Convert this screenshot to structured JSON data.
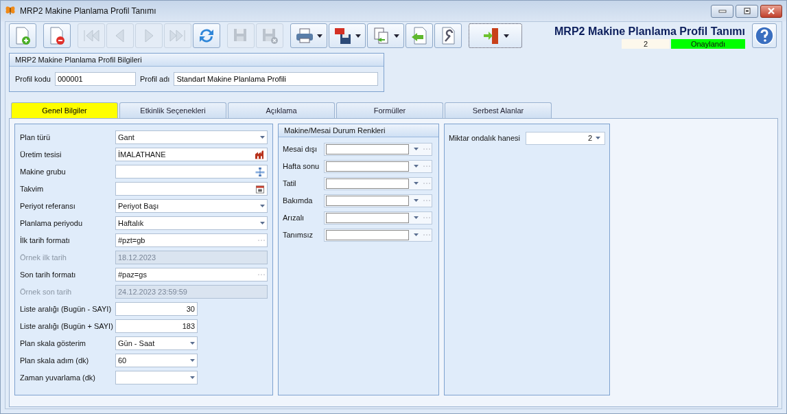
{
  "window": {
    "title": "MRP2 Makine Planlama Profil Tanımı"
  },
  "toolbar": [
    {
      "kind": "new",
      "disabled": false,
      "menu": false
    },
    {
      "kind": "delete",
      "disabled": false,
      "menu": false
    },
    {
      "kind": "first",
      "disabled": true,
      "menu": false
    },
    {
      "kind": "prev",
      "disabled": true,
      "menu": false
    },
    {
      "kind": "next",
      "disabled": true,
      "menu": false
    },
    {
      "kind": "last",
      "disabled": true,
      "menu": false
    },
    {
      "kind": "refresh",
      "disabled": false,
      "menu": false
    },
    {
      "kind": "save",
      "disabled": true,
      "menu": false
    },
    {
      "kind": "cancel",
      "disabled": true,
      "menu": false
    },
    {
      "kind": "print",
      "disabled": false,
      "menu": true
    },
    {
      "kind": "pdf",
      "disabled": false,
      "menu": true
    },
    {
      "kind": "copy",
      "disabled": false,
      "menu": true
    },
    {
      "kind": "import",
      "disabled": false,
      "menu": false
    },
    {
      "kind": "tools",
      "disabled": false,
      "menu": false
    },
    {
      "kind": "exit",
      "disabled": false,
      "menu": true
    }
  ],
  "header": {
    "title": "MRP2 Makine Planlama Profil Tanımı",
    "record_no": "2",
    "status": "Onaylandı"
  },
  "profile": {
    "title": "MRP2 Makine Planlama Profil Bilgileri",
    "code_label": "Profil kodu",
    "code": "000001",
    "name_label": "Profil adı",
    "name": "Standart Makine Planlama Profili"
  },
  "tabs": [
    {
      "label": "Genel Bilgiler",
      "selected": true
    },
    {
      "label": "Etkinlik Seçenekleri",
      "selected": false
    },
    {
      "label": "Açıklama",
      "selected": false
    },
    {
      "label": "Formüller",
      "selected": false
    },
    {
      "label": "Serbest Alanlar",
      "selected": false
    }
  ],
  "general": [
    {
      "label": "Plan türü",
      "value": "Gant",
      "kind": "dropdown",
      "disabled": false
    },
    {
      "label": "Üretim tesisi",
      "value": "İMALATHANE",
      "kind": "factory",
      "disabled": false
    },
    {
      "label": "Makine grubu",
      "kind": "tree",
      "disabled": false
    },
    {
      "label": "Takvim",
      "kind": "calendar",
      "disabled": false
    },
    {
      "label": "Periyot referansı",
      "value": "Periyot Başı",
      "kind": "dropdown",
      "disabled": false
    },
    {
      "label": "Planlama periyodu",
      "value": "Haftalık",
      "kind": "dropdown",
      "disabled": false
    },
    {
      "label": "İlk tarih formatı",
      "value": "#pzt=gb",
      "kind": "ellipsis",
      "disabled": false
    },
    {
      "label": "Örnek ilk tarih",
      "value": "18.12.2023",
      "kind": "text",
      "disabled": true
    },
    {
      "label": "Son tarih formatı",
      "value": "#paz=gs",
      "kind": "ellipsis",
      "disabled": false
    },
    {
      "label": "Örnek son tarih",
      "value": "24.12.2023 23:59:59",
      "kind": "text",
      "disabled": true
    },
    {
      "label": "Liste aralığı (Bugün - SAYI)",
      "value": "30",
      "kind": "number",
      "disabled": false
    },
    {
      "label": "Liste aralığı (Bugün + SAYI)",
      "value": "183",
      "kind": "number",
      "disabled": false
    },
    {
      "label": "Plan skala gösterim",
      "value": "Gün - Saat",
      "kind": "short-dropdown",
      "disabled": false
    },
    {
      "label": "Plan skala adım (dk)",
      "value": "60",
      "kind": "short-dropdown",
      "disabled": false
    },
    {
      "label": "Zaman yuvarlama (dk)",
      "kind": "short-dropdown",
      "disabled": false
    }
  ],
  "colors": {
    "title": "Makine/Mesai Durum Renkleri",
    "rows": [
      "Mesai dışı",
      "Hafta sonu",
      "Tatil",
      "Bakımda",
      "Arızalı",
      "Tanımsız"
    ]
  },
  "decimals": {
    "label": "Miktar ondalık hanesi",
    "value": "2"
  }
}
